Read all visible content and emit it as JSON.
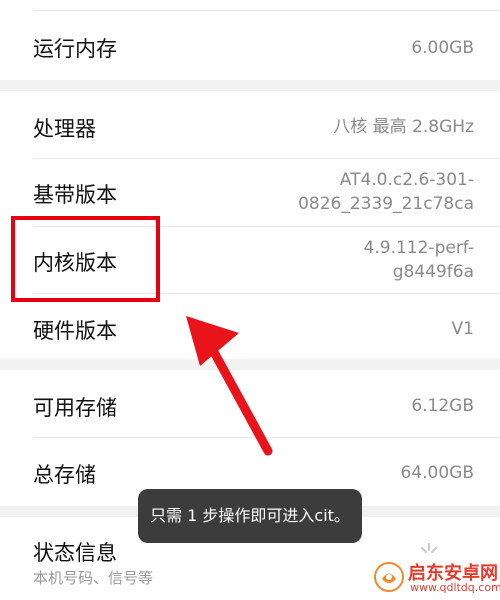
{
  "rows": {
    "ram": {
      "label": "运行内存",
      "value": "6.00GB"
    },
    "processor": {
      "label": "处理器",
      "value": "八核 最高 2.8GHz"
    },
    "baseband": {
      "label": "基带版本",
      "value_line1": "AT4.0.c2.6-301-",
      "value_line2": "0826_2339_21c78ca"
    },
    "kernel": {
      "label": "内核版本",
      "value_line1": "4.9.112-perf-",
      "value_line2": "g8449f6a"
    },
    "hardware": {
      "label": "硬件版本",
      "value": "V1"
    },
    "available_storage": {
      "label": "可用存储",
      "value": "6.12GB"
    },
    "total_storage": {
      "label": "总存储",
      "value": "64.00GB"
    },
    "status": {
      "label": "状态信息",
      "subtitle": "本机号码、信号等"
    }
  },
  "toast": {
    "text": "只需 1 步操作即可进入cit。"
  },
  "watermark": {
    "title": "启东安卓网",
    "url": "www.qdltdq.com"
  },
  "colors": {
    "highlight": "#e60012",
    "arrow": "#e8141a",
    "toast_bg": "#3c3c3c",
    "section_bg": "#ffffff",
    "page_bg": "#f2f2f2"
  },
  "icons": {
    "arrow": "red-arrow-icon",
    "logo": "qidong-logo-icon",
    "spinner": "loading-spinner-icon"
  }
}
